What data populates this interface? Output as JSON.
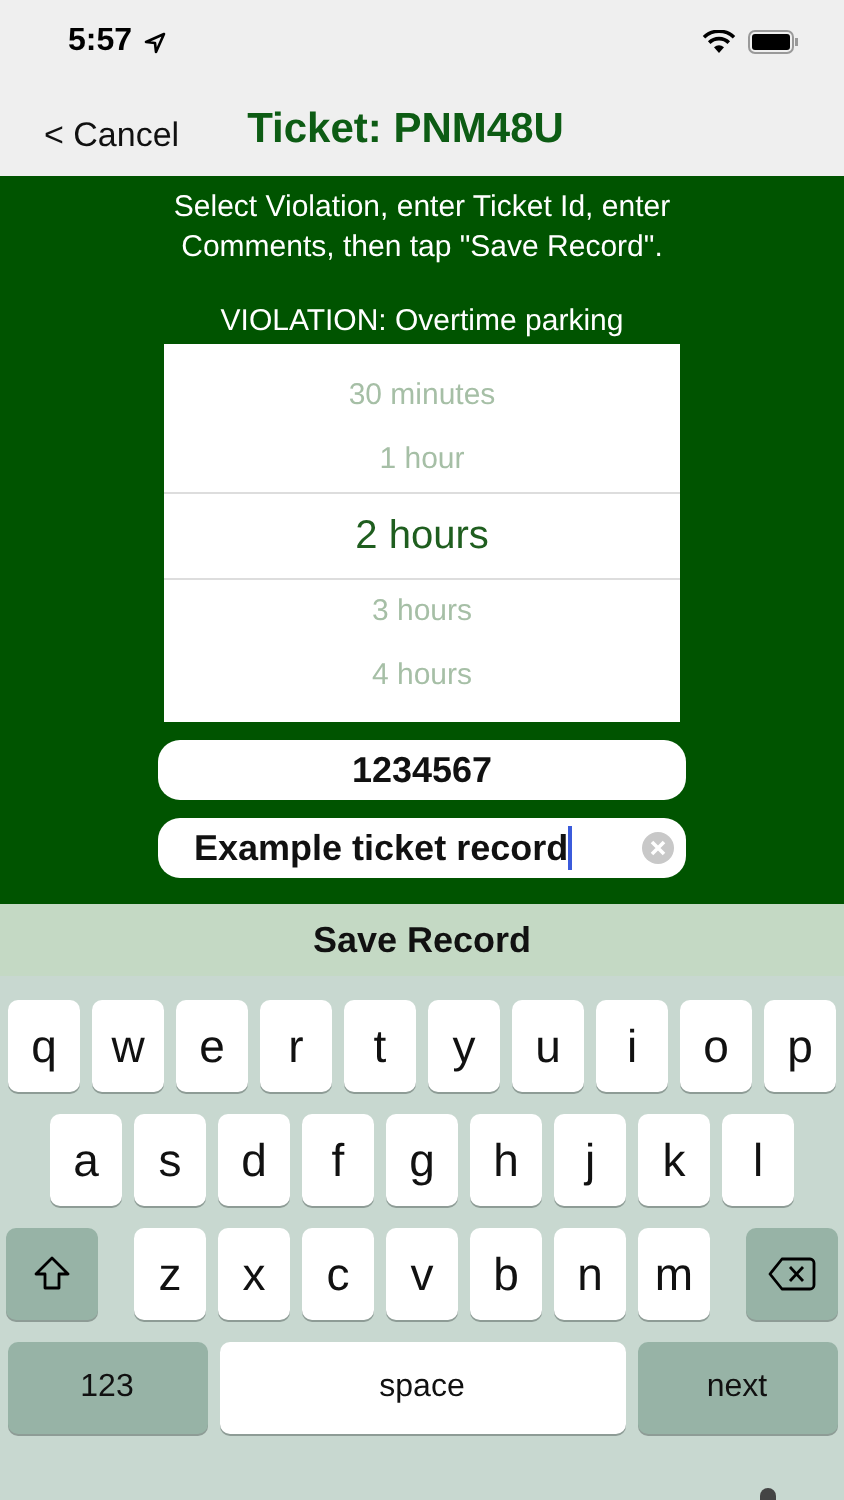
{
  "status_bar": {
    "time": "5:57"
  },
  "nav": {
    "back": "< Cancel",
    "title": "Ticket: PNM48U"
  },
  "instructions": "Select Violation, enter Ticket Id, enter Comments, then tap \"Save Record\".",
  "violation": "VIOLATION: Overtime parking",
  "picker": {
    "options": [
      {
        "label": "30 minutes",
        "selected": false
      },
      {
        "label": "1 hour",
        "selected": false
      },
      {
        "label": "2 hours",
        "selected": true
      },
      {
        "label": "3 hours",
        "selected": false
      },
      {
        "label": "4 hours",
        "selected": false
      }
    ]
  },
  "ticket_id": {
    "value": "1234567"
  },
  "comments": {
    "value": "Example ticket record"
  },
  "save_button": "Save Record",
  "keyboard": {
    "rows": [
      {
        "keys": [
          {
            "label": "q",
            "kind": "letter"
          },
          {
            "label": "w",
            "kind": "letter"
          },
          {
            "label": "e",
            "kind": "letter"
          },
          {
            "label": "r",
            "kind": "letter"
          },
          {
            "label": "t",
            "kind": "letter"
          },
          {
            "label": "y",
            "kind": "letter"
          },
          {
            "label": "u",
            "kind": "letter"
          },
          {
            "label": "i",
            "kind": "letter"
          },
          {
            "label": "o",
            "kind": "letter"
          },
          {
            "label": "p",
            "kind": "letter"
          }
        ]
      },
      {
        "keys": [
          {
            "label": "a",
            "kind": "letter"
          },
          {
            "label": "s",
            "kind": "letter"
          },
          {
            "label": "d",
            "kind": "letter"
          },
          {
            "label": "f",
            "kind": "letter"
          },
          {
            "label": "g",
            "kind": "letter"
          },
          {
            "label": "h",
            "kind": "letter"
          },
          {
            "label": "j",
            "kind": "letter"
          },
          {
            "label": "k",
            "kind": "letter"
          },
          {
            "label": "l",
            "kind": "letter"
          }
        ]
      },
      {
        "keys": [
          {
            "kind": "shift"
          },
          {
            "label": "z",
            "kind": "letter"
          },
          {
            "label": "x",
            "kind": "letter"
          },
          {
            "label": "c",
            "kind": "letter"
          },
          {
            "label": "v",
            "kind": "letter"
          },
          {
            "label": "b",
            "kind": "letter"
          },
          {
            "label": "n",
            "kind": "letter"
          },
          {
            "label": "m",
            "kind": "letter"
          },
          {
            "kind": "delete"
          }
        ]
      },
      {
        "keys": [
          {
            "label": "123",
            "kind": "mode"
          },
          {
            "label": "space",
            "kind": "space"
          },
          {
            "label": "next",
            "kind": "mode"
          }
        ]
      }
    ]
  }
}
